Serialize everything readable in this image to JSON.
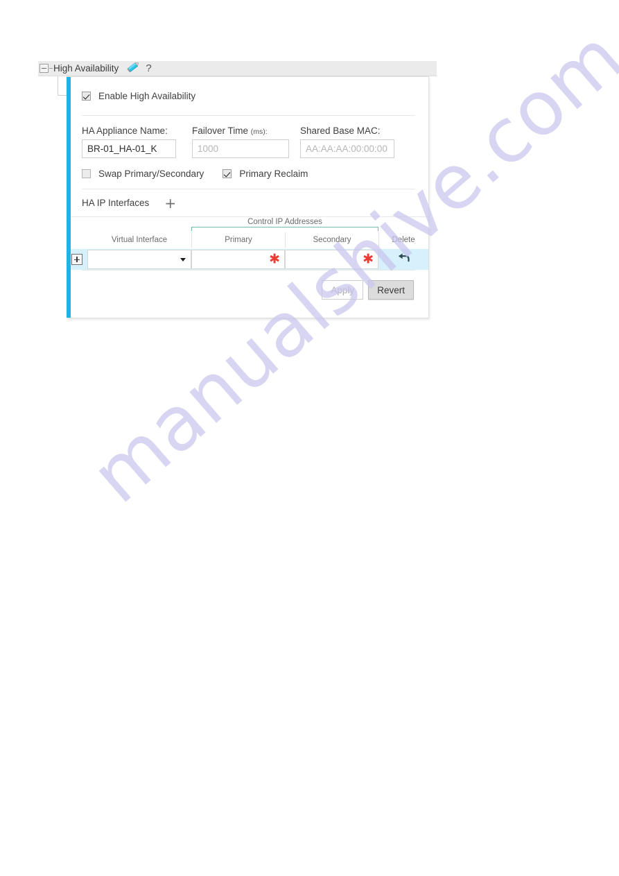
{
  "panel": {
    "title": "High Availability",
    "collapse_icon": "minus-square-icon",
    "edit_icon": "pencil-icon",
    "help_icon": "?"
  },
  "enable": {
    "label": "Enable High Availability",
    "checked": true
  },
  "fields": {
    "appliance_name": {
      "label": "HA Appliance Name:",
      "value": "BR-01_HA-01_K",
      "placeholder": ""
    },
    "failover_time": {
      "label": "Failover Time",
      "unit": "(ms):",
      "value": "",
      "placeholder": "1000"
    },
    "shared_base_mac": {
      "label": "Shared Base MAC:",
      "value": "",
      "placeholder": "AA:AA:AA:00:00:00"
    }
  },
  "toggles": {
    "swap": {
      "label": "Swap Primary/Secondary",
      "checked": false
    },
    "reclaim": {
      "label": "Primary Reclaim",
      "checked": true
    }
  },
  "ha_ip": {
    "title": "HA IP Interfaces",
    "add_icon": "+"
  },
  "table": {
    "group_header": "Control IP Addresses",
    "columns": [
      "Virtual Interface",
      "Primary",
      "Secondary",
      "Delete"
    ],
    "rows": [
      {
        "expand_icon": "plus-square-icon",
        "virtual_interface": "",
        "primary": "",
        "secondary": "",
        "primary_required": "✱",
        "secondary_required": "✱",
        "delete_icon": "undo-arrow-icon"
      }
    ]
  },
  "actions": {
    "apply": "Apply",
    "revert": "Revert"
  },
  "watermark": {
    "text": "manualshive.com"
  },
  "colors": {
    "accent": "#1cb5e0",
    "row_highlight": "#d6f1fb",
    "required": "#ec3b32",
    "bracket": "#74b9ae",
    "header_bg": "#ebebeb"
  }
}
